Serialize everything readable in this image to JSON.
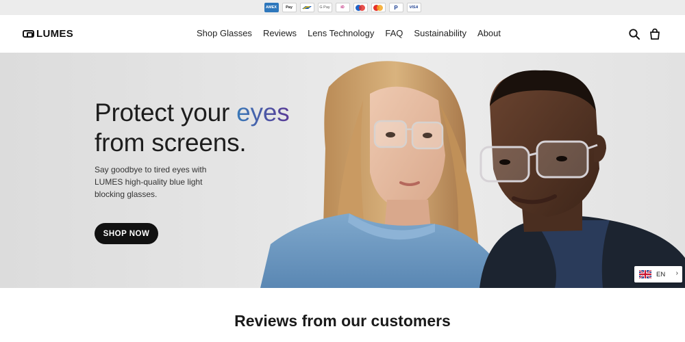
{
  "payment_methods": [
    {
      "name": "American Express",
      "icon": "amex-icon",
      "label": "AMEX"
    },
    {
      "name": "Apple Pay",
      "icon": "apple-pay-icon",
      "label": "Pay"
    },
    {
      "name": "Bancontact",
      "icon": "bancontact-icon",
      "label": ""
    },
    {
      "name": "Google Pay",
      "icon": "google-pay-icon",
      "label": "G Pay"
    },
    {
      "name": "iDEAL",
      "icon": "ideal-icon",
      "label": "iD"
    },
    {
      "name": "Maestro",
      "icon": "maestro-icon",
      "label": ""
    },
    {
      "name": "Mastercard",
      "icon": "mastercard-icon",
      "label": ""
    },
    {
      "name": "PayPal",
      "icon": "paypal-icon",
      "label": "P"
    },
    {
      "name": "Visa",
      "icon": "visa-icon",
      "label": "VISA"
    }
  ],
  "header": {
    "logo_text": "LUMES",
    "nav": [
      "Shop Glasses",
      "Reviews",
      "Lens Technology",
      "FAQ",
      "Sustainability",
      "About"
    ]
  },
  "hero": {
    "title_part1": "Protect your ",
    "title_accent": "eyes",
    "title_line2": "from screens.",
    "subtitle": "Say goodbye to tired eyes with LUMES high-quality blue light blocking glasses.",
    "cta_label": "SHOP NOW"
  },
  "language": {
    "code": "EN",
    "flag": "uk-flag-icon"
  },
  "reviews": {
    "title": "Reviews from our customers"
  },
  "colors": {
    "accent_start": "#3a7ab8",
    "accent_end": "#5a3a96",
    "button": "#111111"
  }
}
